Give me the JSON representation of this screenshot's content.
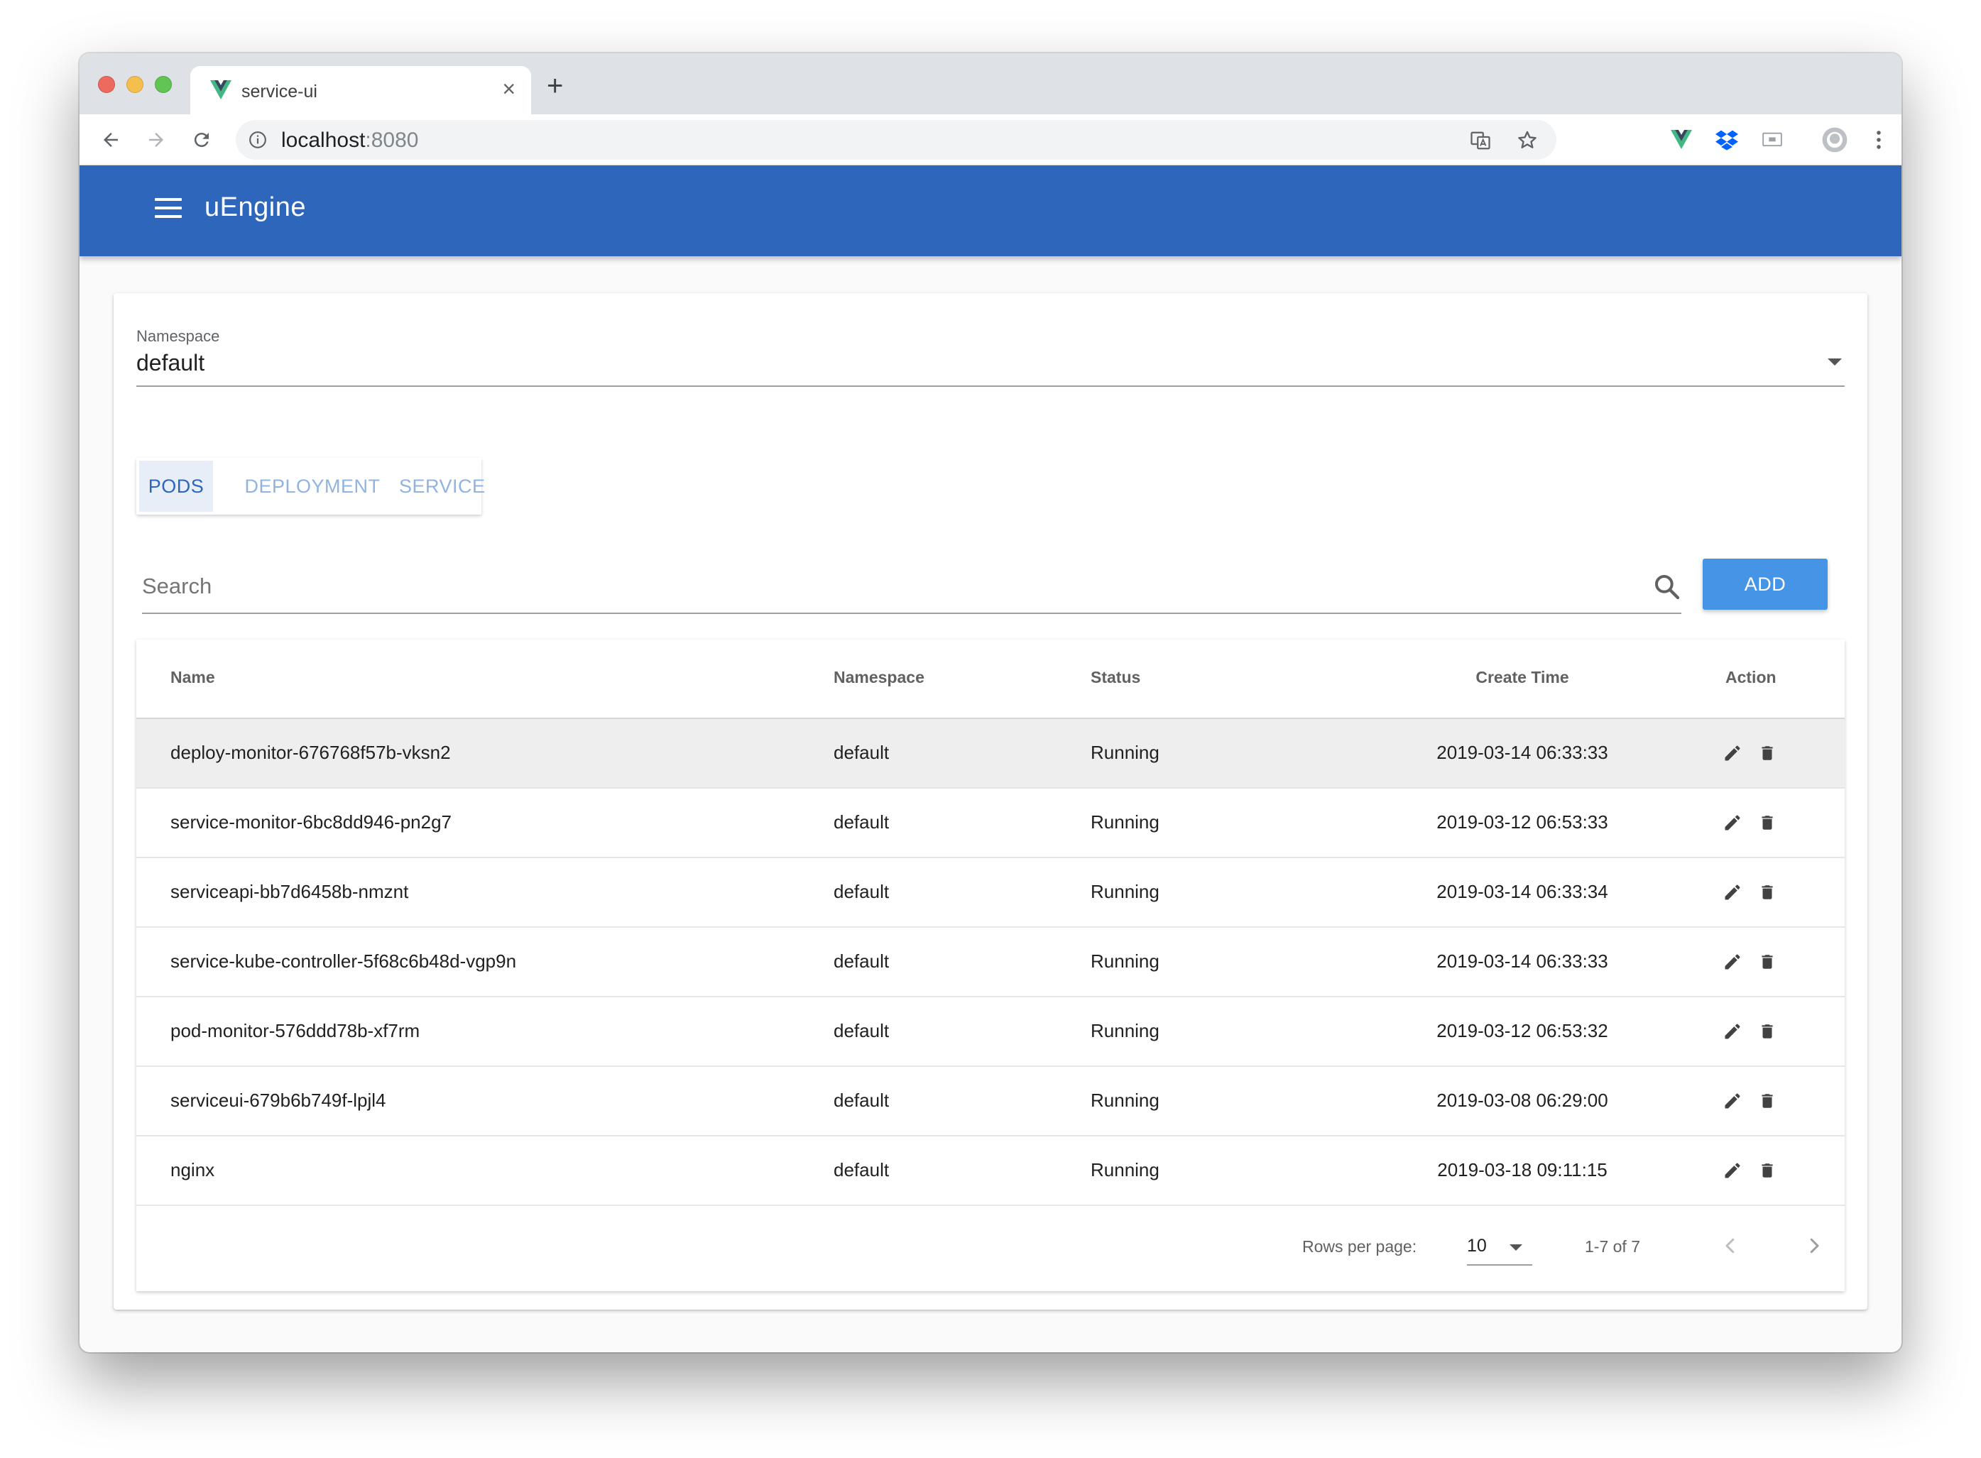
{
  "browser": {
    "tab_title": "service-ui",
    "tab_close": "×",
    "new_tab": "+",
    "url_host": "localhost",
    "url_port": ":8080"
  },
  "app": {
    "title": "uEngine"
  },
  "namespace": {
    "label": "Namespace",
    "value": "default"
  },
  "tabs": [
    {
      "label": "PODS",
      "active": true
    },
    {
      "label": "DEPLOYMENT",
      "active": false
    },
    {
      "label": "SERVICE",
      "active": false
    }
  ],
  "search": {
    "placeholder": "Search",
    "value": ""
  },
  "add_button": "ADD",
  "table": {
    "headers": [
      "Name",
      "Namespace",
      "Status",
      "Create Time",
      "Action"
    ],
    "rows": [
      {
        "name": "deploy-monitor-676768f57b-vksn2",
        "namespace": "default",
        "status": "Running",
        "create_time": "2019-03-14 06:33:33"
      },
      {
        "name": "service-monitor-6bc8dd946-pn2g7",
        "namespace": "default",
        "status": "Running",
        "create_time": "2019-03-12 06:53:33"
      },
      {
        "name": "serviceapi-bb7d6458b-nmznt",
        "namespace": "default",
        "status": "Running",
        "create_time": "2019-03-14 06:33:34"
      },
      {
        "name": "service-kube-controller-5f68c6b48d-vgp9n",
        "namespace": "default",
        "status": "Running",
        "create_time": "2019-03-14 06:33:33"
      },
      {
        "name": "pod-monitor-576ddd78b-xf7rm",
        "namespace": "default",
        "status": "Running",
        "create_time": "2019-03-12 06:53:32"
      },
      {
        "name": "serviceui-679b6b749f-lpjl4",
        "namespace": "default",
        "status": "Running",
        "create_time": "2019-03-08 06:29:00"
      },
      {
        "name": "nginx",
        "namespace": "default",
        "status": "Running",
        "create_time": "2019-03-18 09:11:15"
      }
    ]
  },
  "pagination": {
    "rows_per_page_label": "Rows per page:",
    "rows_per_page": "10",
    "range": "1-7 of 7"
  },
  "colors": {
    "appbar": "#2d66bb",
    "add_button": "#4694e6",
    "tab_active": "#2d66bb",
    "tab_inactive": "#90b3e0"
  }
}
